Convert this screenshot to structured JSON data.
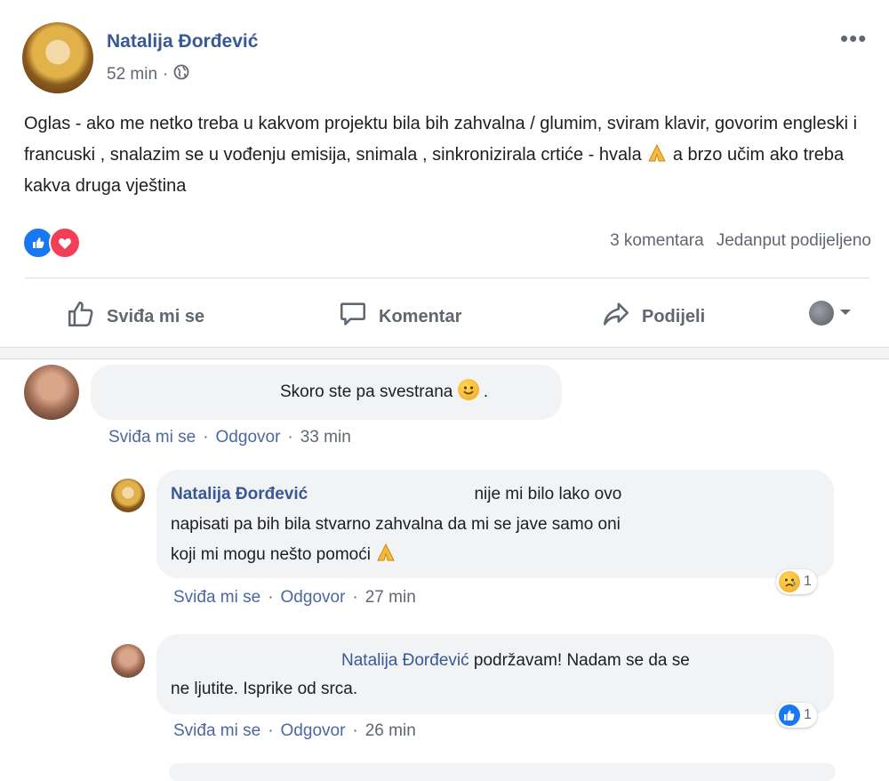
{
  "post": {
    "author": "Natalija Đorđević",
    "time": "52 min",
    "audience_separator": "·",
    "text_part1": "Oglas - ako me netko treba u kakvom projektu bila bih zahvalna / glumim, sviram klavir, govorim engleski i francuski , snalazim se u vođenju emisija, snimala , sinkronizirala crtiće - hvala",
    "text_part2": "a brzo učim ako treba kakva druga vještina",
    "comments_count": "3 komentara",
    "shares": "Jedanput podijeljeno"
  },
  "actions": {
    "like": "Sviđa mi se",
    "comment": "Komentar",
    "share": "Podijeli"
  },
  "comments": [
    {
      "text": "Skoro ste pa svestrana",
      "like": "Sviđa mi se",
      "reply": "Odgovor",
      "time": "33 min"
    },
    {
      "author": "Natalija Đorđević",
      "text_line1": "nije mi bilo lako ovo",
      "text_line2": "napisati pa bih bila stvarno zahvalna da mi se jave samo oni",
      "text_line3": "koji mi mogu nešto pomoći",
      "reaction_count": "1",
      "like": "Sviđa mi se",
      "reply": "Odgovor",
      "time": "27 min"
    },
    {
      "mention": "Natalija Đorđević",
      "text_line1": "podržavam! Nadam se da se",
      "text_line2": "ne ljutite. Isprike od srca.",
      "reaction_count": "1",
      "like": "Sviđa mi se",
      "reply": "Odgovor",
      "time": "26 min"
    }
  ],
  "meta_separator": "·",
  "colors": {
    "link_blue": "#385898",
    "like_blue": "#1877f2",
    "love_red": "#f33e58",
    "meta_gray": "#606770",
    "bubble_gray": "#f2f3f5"
  },
  "icons": [
    "globe-icon",
    "more-icon",
    "like-reaction-icon",
    "love-reaction-icon",
    "thumbs-up-icon",
    "comment-icon",
    "share-icon",
    "audience-selector-icon",
    "pray-emoji",
    "smile-emoji",
    "sad-reaction-icon"
  ]
}
